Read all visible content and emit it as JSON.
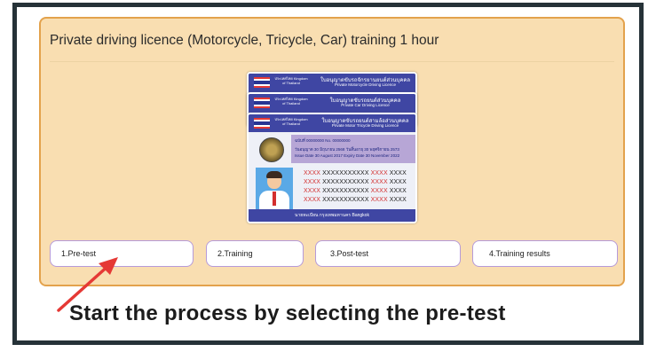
{
  "page": {
    "title": "Private driving licence (Motorcycle, Tricycle, Car) training 1 hour"
  },
  "cards": {
    "back": {
      "header_left": "ประเทศไทย Kingdom of Thailand",
      "header_th": "ใบอนุญาตขับรถจักรยานยนต์ส่วนบุคคล",
      "header_en": "Private Motorcycle Driving Licence"
    },
    "middle": {
      "header_left": "ประเทศไทย Kingdom of Thailand",
      "header_th": "ใบอนุญาตขับรถยนต์ส่วนบุคคล",
      "header_en": "Private Car Driving Licence"
    },
    "front": {
      "header_left": "ประเทศไทย Kingdom of Thailand",
      "header_th": "ใบอนุญาตขับรถยนต์สามล้อส่วนบุคคล",
      "header_en": "Private Motor Tricycle Driving Licence",
      "info1": "ฉบับที่ 00000000   No. 00000000",
      "info2": "วันอนุญาต 30 มิถุนายน 2568   วันสิ้นอายุ 30 พฤศจิกายน 2573",
      "info3": "Issue Date 30 August 2017   Expiry Date 30 November 2022",
      "lines": [
        [
          "XXXX ",
          "XXXXXXXXXXX ",
          "XXXX ",
          "XXXX"
        ],
        [
          "XXXX ",
          "XXXXXXXXXXX ",
          "XXXX ",
          "XXXX"
        ],
        [
          "XXXX ",
          "XXXXXXXXXXX ",
          "XXXX ",
          "XXXX"
        ],
        [
          "XXXX ",
          "XXXXXXXXXXX ",
          "XXXX ",
          "XXXX"
        ]
      ],
      "footer": "นายทะเบียน กรุงเทพมหานคร Bangkok"
    }
  },
  "steps": [
    {
      "label": "1.Pre-test"
    },
    {
      "label": "2.Training"
    },
    {
      "label": "3.Post-test"
    },
    {
      "label": "4.Training results"
    }
  ],
  "annotation": {
    "caption": "Start the process by selecting the pre-test",
    "arrow_color": "#e53935"
  }
}
